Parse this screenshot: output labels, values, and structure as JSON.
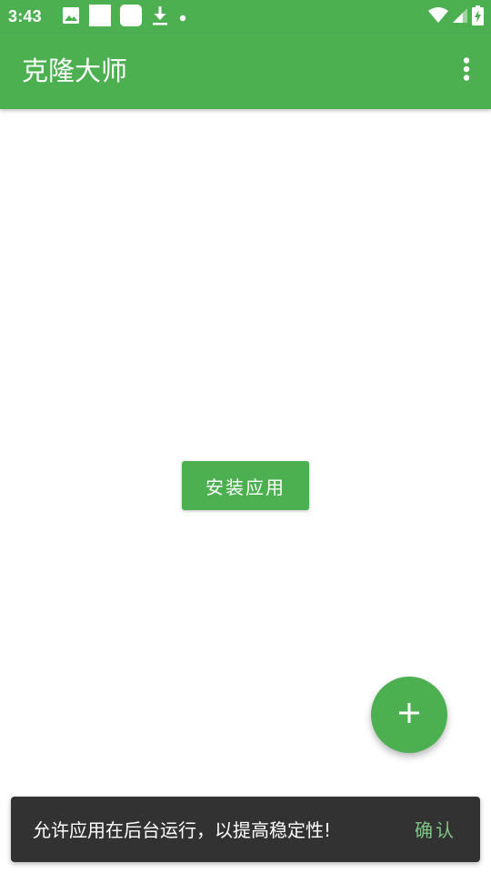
{
  "status_bar": {
    "time": "3:43",
    "left_icons": [
      "image-icon",
      "notification-square-icon",
      "notification-rounded-square-icon",
      "download-icon",
      "dot-icon"
    ],
    "right_icons": [
      "wifi-icon",
      "signal-icon",
      "battery-charging-icon"
    ]
  },
  "app_bar": {
    "title": "克隆大师",
    "menu_icon": "more-vert-icon"
  },
  "main": {
    "install_button_label": "安装应用"
  },
  "fab": {
    "icon": "plus-icon"
  },
  "snackbar": {
    "message": "允许应用在后台运行，以提高稳定性!",
    "action_label": "确认"
  },
  "colors": {
    "primary": "#4caf50",
    "snackbar_bg": "#323232",
    "snackbar_action": "#81c784",
    "on_primary": "#ffffff"
  }
}
